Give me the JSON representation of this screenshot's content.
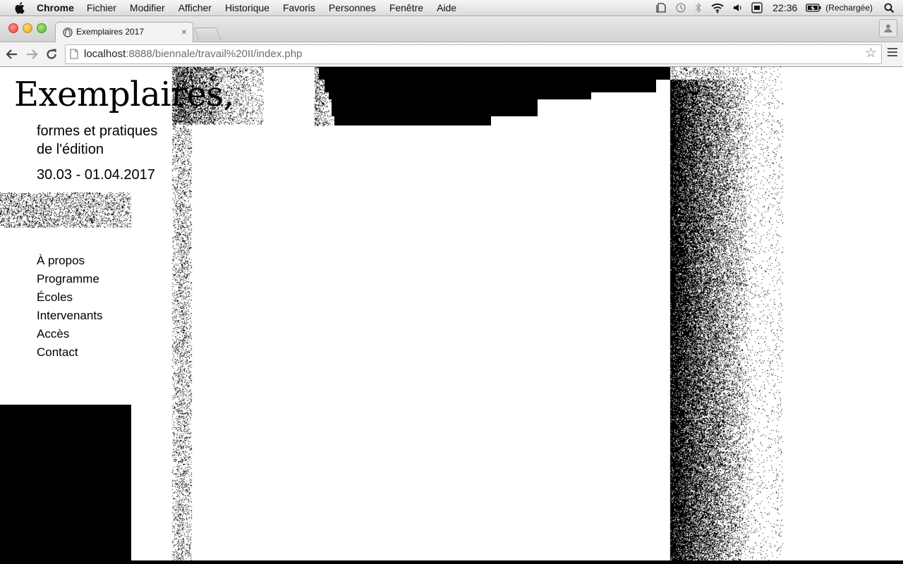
{
  "os_menubar": {
    "app_name": "Chrome",
    "menus": [
      "Fichier",
      "Modifier",
      "Afficher",
      "Historique",
      "Favoris",
      "Personnes",
      "Fenêtre",
      "Aide"
    ],
    "clock": "22:36",
    "battery_label": "(Rechargée)"
  },
  "browser": {
    "tab": {
      "title": "Exemplaires 2017"
    },
    "address": {
      "host": "localhost",
      "path": ":8888/biennale/travail%20II/index.php"
    }
  },
  "site": {
    "title": "Exemplaires,",
    "subtitle_line1": "formes et pratiques",
    "subtitle_line2": "de l'édition",
    "dates": "30.03 - 01.04.2017",
    "nav": [
      "À propos",
      "Programme",
      "Écoles",
      "Intervenants",
      "Accès",
      "Contact"
    ]
  },
  "colors": {
    "ink": "#000000",
    "paper": "#ffffff"
  }
}
